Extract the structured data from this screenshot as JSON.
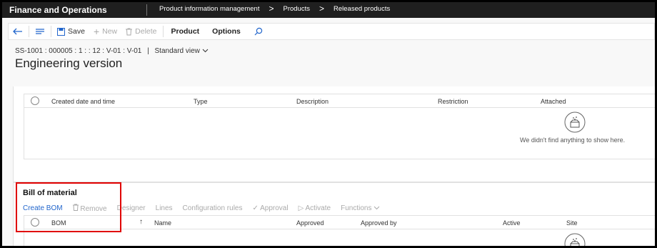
{
  "app": {
    "title": "Finance and Operations"
  },
  "breadcrumb": [
    "Product information management",
    "Products",
    "Released products"
  ],
  "actionbar": {
    "save": "Save",
    "new": "New",
    "delete": "Delete",
    "product": "Product",
    "options": "Options"
  },
  "record": {
    "id": "SS-1001 : 000005 : 1 : : 12 : V-01 : V-01",
    "separator": "|",
    "view": "Standard view"
  },
  "page_title": "Engineering version",
  "attachments_grid": {
    "columns": [
      "Created date and time",
      "Type",
      "Description",
      "Restriction",
      "Attached"
    ],
    "empty_message": "We didn't find anything to show here."
  },
  "bom_section": {
    "title": "Bill of material",
    "toolbar": [
      "Create BOM",
      "Remove",
      "Designer",
      "Lines",
      "Configuration rules",
      "Approval",
      "Activate",
      "Functions"
    ],
    "columns": [
      "BOM",
      "Name",
      "Approved",
      "Approved by",
      "Active",
      "Site"
    ]
  },
  "colors": {
    "highlight": "#e00000",
    "link": "#2266cc",
    "topbar": "#1f1f1f"
  }
}
